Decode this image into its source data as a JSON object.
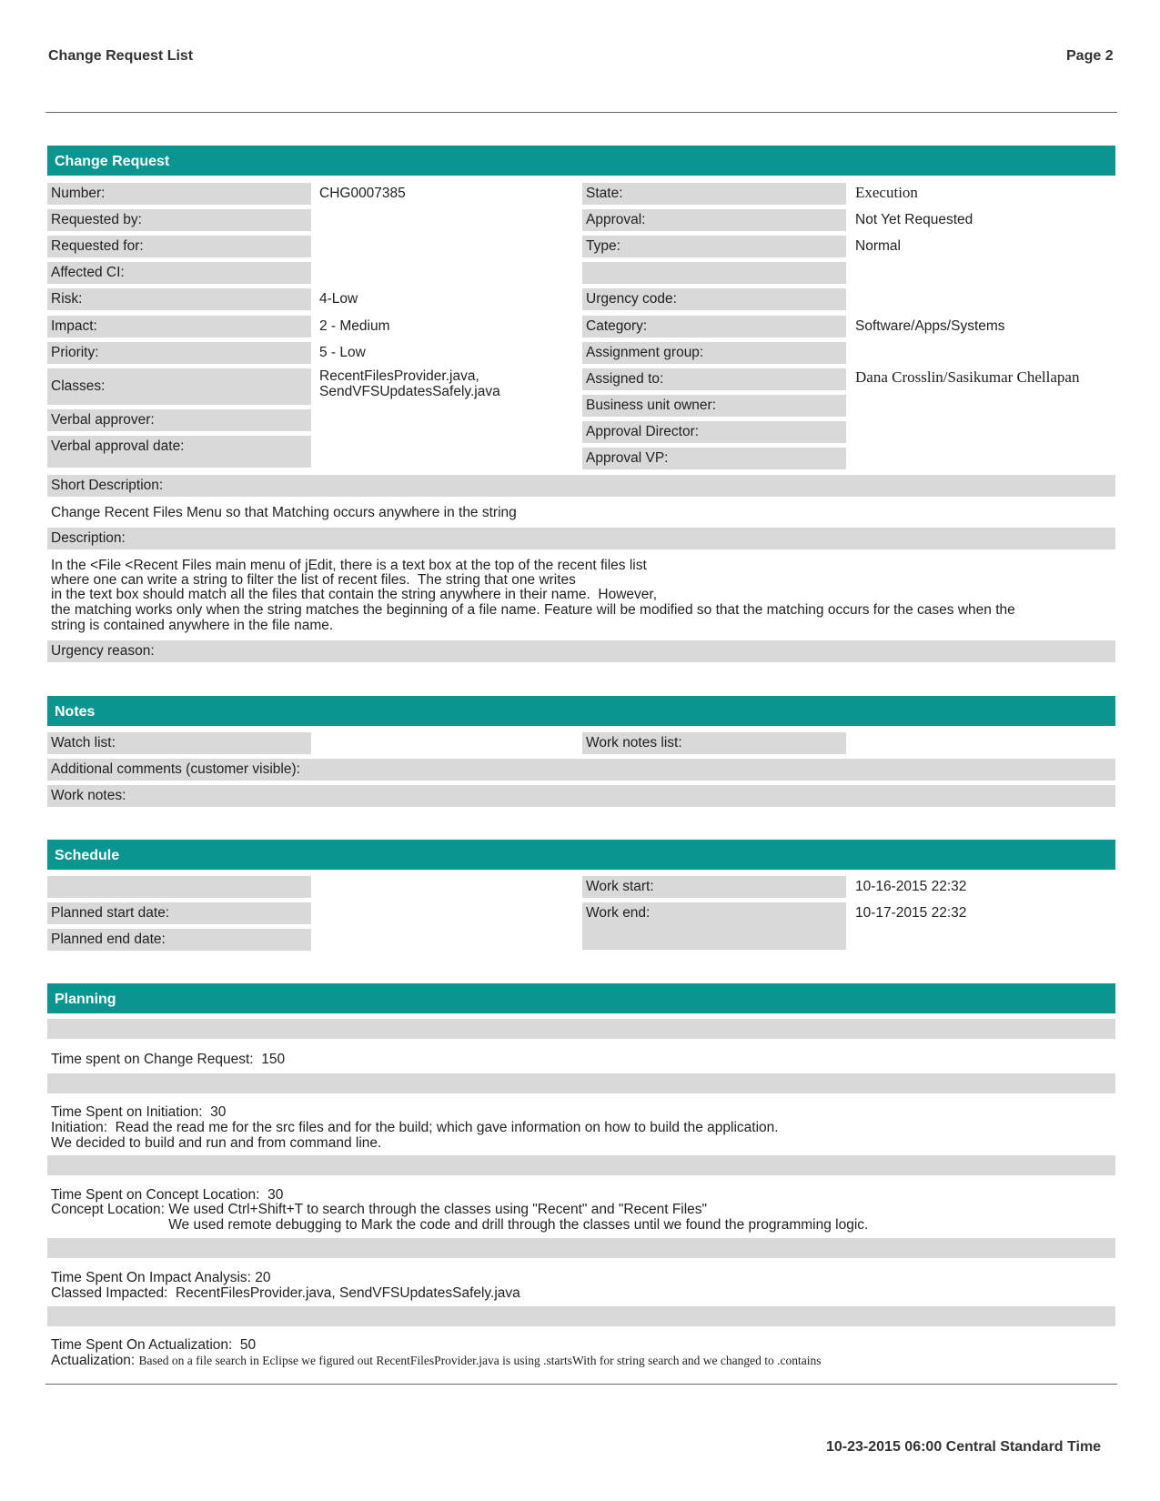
{
  "header": {
    "title": "Change Request List",
    "page": "Page 2"
  },
  "change_request": {
    "section_title": "Change Request",
    "left": {
      "number_label": "Number:",
      "number_value": "CHG0007385",
      "requested_by_label": "Requested by:",
      "requested_for_label": "Requested for:",
      "affected_ci_label": "Affected CI:",
      "risk_label": "Risk:",
      "risk_value": "4-Low",
      "impact_label": "Impact:",
      "impact_value": "2 - Medium",
      "priority_label": "Priority:",
      "priority_value": "5 - Low",
      "classes_label": "Classes:",
      "classes_value_1": "RecentFilesProvider.java,",
      "classes_value_2": "SendVFSUpdatesSafely.java",
      "verbal_approver_label": "Verbal approver:",
      "verbal_approval_date_label": "Verbal approval date:"
    },
    "right": {
      "state_label": "State:",
      "state_value": "Execution",
      "approval_label": "Approval:",
      "approval_value": "Not Yet Requested",
      "type_label": "Type:",
      "type_value": "Normal",
      "urgency_code_label": "Urgency code:",
      "category_label": "Category:",
      "category_value": "Software/Apps/Systems",
      "assignment_group_label": "Assignment group:",
      "assigned_to_label": "Assigned to:",
      "assigned_to_value": "Dana Crosslin/Sasikumar Chellapan",
      "business_unit_owner_label": "Business unit owner:",
      "approval_director_label": "Approval Director:",
      "approval_vp_label": "Approval VP:"
    },
    "short_description_label": "Short Description:",
    "short_description_value": "Change Recent Files Menu so that Matching occurs anywhere in the string",
    "description_label": "Description:",
    "description_lines": [
      "In the <File <Recent Files main menu of jEdit, there is a text box at the top of the recent files list",
      "where one can write a string to filter the list of recent files.  The string that one writes",
      "in the text box should match all the files that contain the string anywhere in their name.  However,",
      "the matching works only when the string matches the beginning of a file name. Feature will be modified so that the matching occurs for the cases when the",
      "string is contained anywhere in the file name."
    ],
    "urgency_reason_label": "Urgency reason:"
  },
  "notes": {
    "section_title": "Notes",
    "watch_list_label": "Watch list:",
    "work_notes_list_label": "Work notes list:",
    "additional_comments_label": "Additional comments (customer visible):",
    "work_notes_label": "Work notes:"
  },
  "schedule": {
    "section_title": "Schedule",
    "planned_start_label": "Planned start date:",
    "planned_end_label": "Planned end date:",
    "work_start_label": "Work start:",
    "work_start_value": "10-16-2015 22:32",
    "work_end_label": "Work end:",
    "work_end_value": "10-17-2015 22:32"
  },
  "planning": {
    "section_title": "Planning",
    "time_spent_cr": "Time spent on Change Request:  150",
    "initiation_lines": [
      "Time Spent on Initiation:  30",
      "Initiation:  Read the read me for the src files and for the build; which gave information on how to build the application.",
      "We decided to build and run and from command line."
    ],
    "concept_lines": [
      "Time Spent on Concept Location:  30",
      "Concept Location: We used Ctrl+Shift+T to search through the classes using \"Recent\" and \"Recent Files\"",
      "                              We used remote debugging to Mark the code and drill through the classes until we found the programming logic."
    ],
    "impact_lines": [
      "Time Spent On Impact Analysis: 20",
      "Classed Impacted:  RecentFilesProvider.java, SendVFSUpdatesSafely.java"
    ],
    "actualization_time": "Time Spent On Actualization:  50",
    "actualization_label": "Actualization: ",
    "actualization_text": "Based on a file search in Eclipse we figured out RecentFilesProvider.java is using .startsWith for string search and we changed to .contains"
  },
  "footer": {
    "timestamp": "10-23-2015 06:00 Central Standard Time"
  }
}
